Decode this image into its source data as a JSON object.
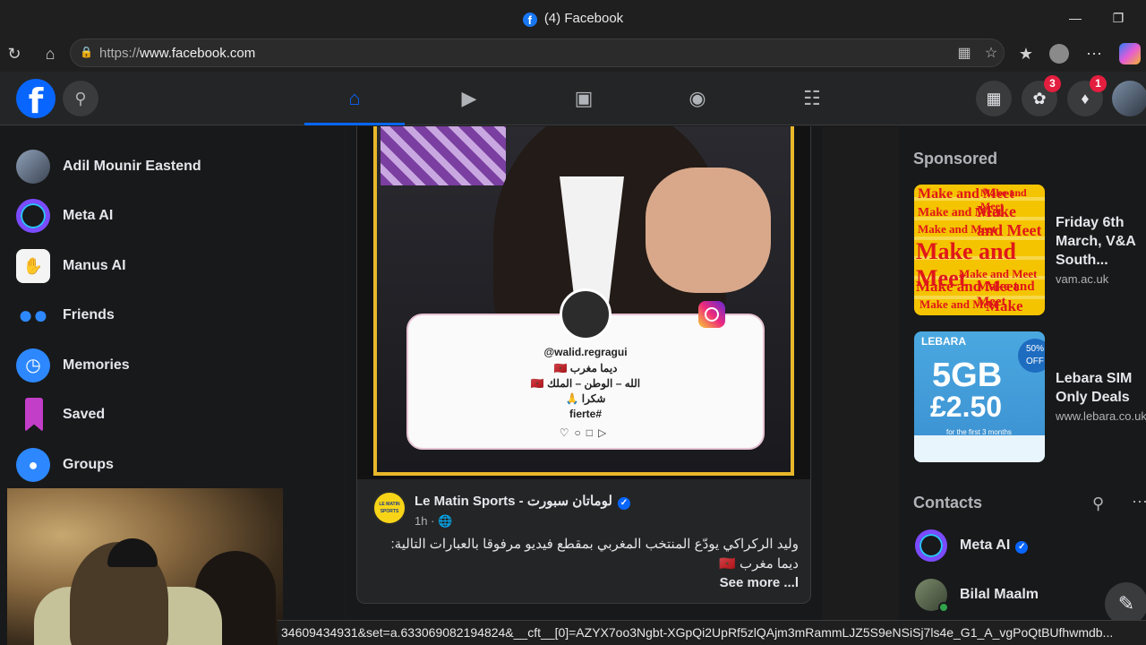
{
  "browser": {
    "title": "(4) Facebook",
    "url_prefix": "https://",
    "url_domain": "www.facebook.com"
  },
  "header": {
    "messenger_badge": "3",
    "notifications_badge": "1"
  },
  "left_nav": {
    "items": [
      {
        "label": "Adil Mounir Eastend",
        "icon": "profile-avatar"
      },
      {
        "label": "Meta AI",
        "icon": "meta-ai-icon"
      },
      {
        "label": "Manus AI",
        "icon": "manus-ai-icon"
      },
      {
        "label": "Friends",
        "icon": "friends-icon"
      },
      {
        "label": "Memories",
        "icon": "memories-icon"
      },
      {
        "label": "Saved",
        "icon": "saved-icon"
      },
      {
        "label": "Groups",
        "icon": "groups-icon"
      }
    ]
  },
  "post": {
    "ig_handle": "@walid.regragui",
    "ig_line1": "ديما مغرب 🇲🇦",
    "ig_line2": "الله – الوطن – الملك 🇲🇦",
    "ig_line3": "شكرا 🙏",
    "ig_line4": "fierte#",
    "page_logo_text": "LE MATIN SPORTS",
    "page_name": "Le Matin Sports - لوماتان سبورت",
    "time": "1h ·",
    "text_line1": "وليد الركراكي يودّع المنتخب المغربي بمقطع فيديو مرفوقا بالعبارات التالية:",
    "text_line2": "ديما مغرب 🇲🇦",
    "see_more": "See more ...l"
  },
  "sponsored": {
    "heading": "Sponsored",
    "ads": [
      {
        "title": "Friday 6th March, V&A South...",
        "url": "vam.ac.uk",
        "image_text": "Make and Meet"
      },
      {
        "title": "Lebara SIM Only Deals",
        "url": "www.lebara.co.uk",
        "brand": "LEBARA",
        "gb": "5GB",
        "price": "£2.50",
        "off": "50% OFF",
        "tiny": "for the first 3 months"
      }
    ]
  },
  "contacts": {
    "heading": "Contacts",
    "items": [
      {
        "name": "Meta AI"
      },
      {
        "name": "Bilal Maalm"
      }
    ]
  },
  "status_url": "34609434931&set=a.633069082194824&__cft__[0]=AZYX7oo3Ngbt-XGpQi2UpRf5zlQAjm3mRammLJZ5S9eNSiSj7ls4e_G1_A_vgPoQtBUfhwmdb...",
  "colors": {
    "brand": "#0866ff",
    "badge": "#e41e3f",
    "background": "#18191a",
    "surface": "#242526"
  }
}
